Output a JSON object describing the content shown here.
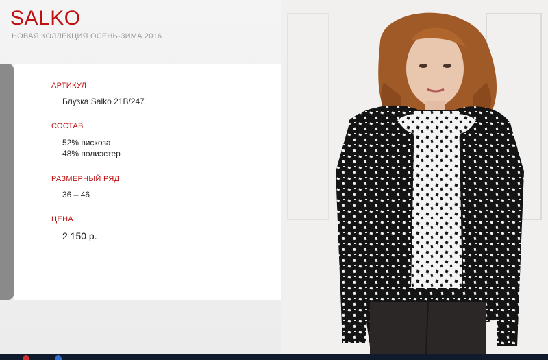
{
  "header": {
    "brand": "SALKO",
    "subtitle": "НОВАЯ КОЛЛЕКЦИЯ ОСЕНЬ-ЗИМА 2016"
  },
  "product": {
    "article_label": "АРТИКУЛ",
    "article_value": "Блузка Salko 21В/247",
    "composition_label": "СОСТАВ",
    "composition_line1": "52% вискоза",
    "composition_line2": "48% полиэстер",
    "size_label": "РАЗМЕРНЫЙ РЯД",
    "size_value": "36 – 46",
    "price_label": "ЦЕНА",
    "price_value": "2 150 р."
  },
  "colors": {
    "brand_red": "#c01010",
    "side_tab": "#8a8a8a",
    "taskbar": "#0f1b2d"
  },
  "icons": [
    "taskbar-app-icon",
    "taskbar-app-icon-2"
  ]
}
